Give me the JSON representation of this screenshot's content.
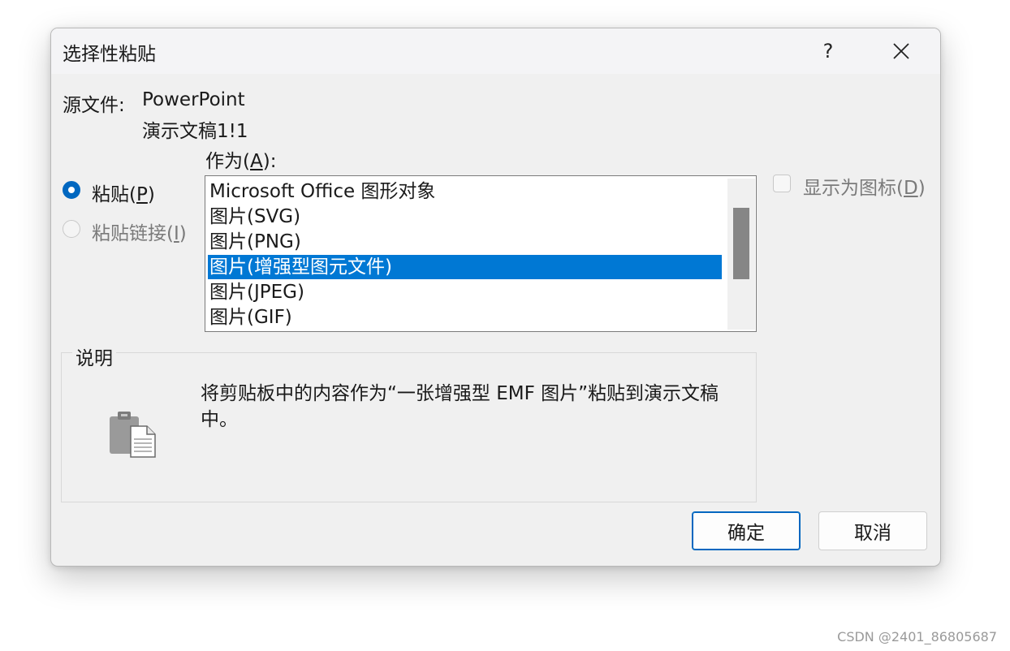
{
  "dialog": {
    "title": "选择性粘贴",
    "help_glyph": "?",
    "close_glyph": "✕",
    "source_label": "源文件:",
    "source_app": "PowerPoint",
    "source_doc": "演示文稿1!1",
    "as_label": "作为(A):",
    "paste_option": "粘贴(P)",
    "paste_link_option": "粘贴链接(I)",
    "display_as_icon": "显示为图标(D)",
    "formats": [
      "Microsoft Office 图形对象",
      "图片(SVG)",
      "图片(PNG)",
      "图片(增强型图元文件)",
      "图片(JPEG)",
      "图片(GIF)"
    ],
    "selected_format": "图片(增强型图元文件)",
    "result_label": "说明",
    "result_text": "将剪贴板中的内容作为“一张增强型 EMF 图片”粘贴到演示文稿中。",
    "ok": "确定",
    "cancel": "取消"
  },
  "watermark": "CSDN @2401_86805687",
  "colors": {
    "accent": "#0067c0",
    "selection": "#0078d4"
  }
}
